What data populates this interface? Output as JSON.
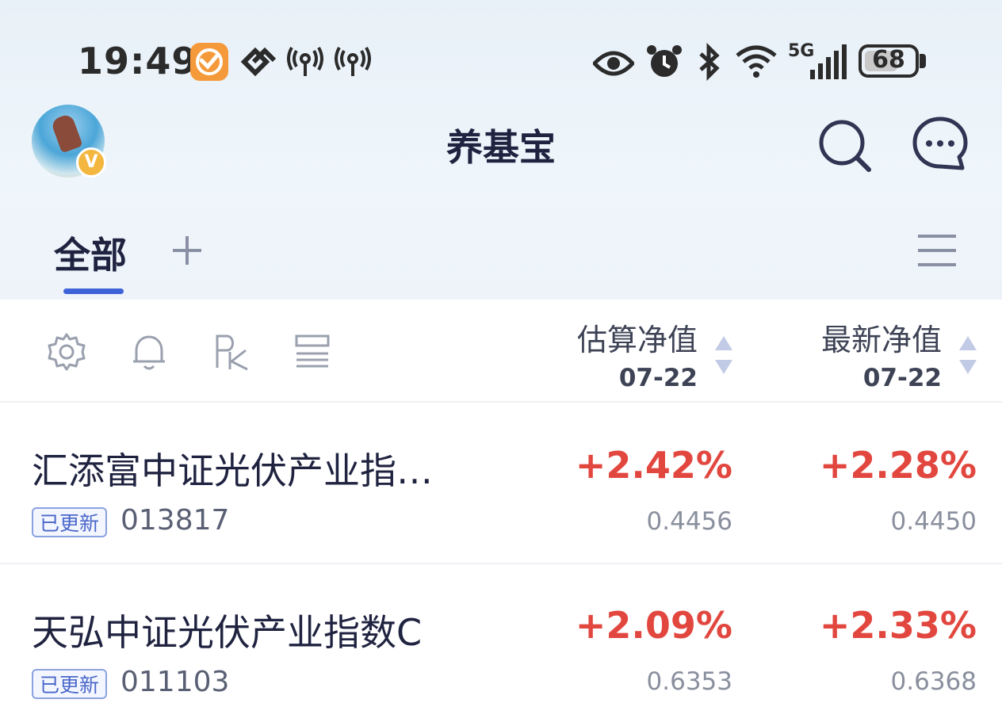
{
  "status_bar": {
    "time": "19:49",
    "network": "5G",
    "battery": "68",
    "icons": [
      "app-badge-icon",
      "link-icon",
      "hotspot-icon",
      "hotspot-icon",
      "eye-icon",
      "alarm-icon",
      "bluetooth-icon",
      "wifi-icon",
      "signal-icon",
      "battery-icon"
    ]
  },
  "header": {
    "title": "养基宝",
    "avatar_badge": "V"
  },
  "tabs": {
    "active": "全部",
    "add_label": "+"
  },
  "columns": {
    "estimate": {
      "label": "估算净值",
      "date": "07-22"
    },
    "latest": {
      "label": "最新净值",
      "date": "07-22"
    }
  },
  "funds": [
    {
      "name": "汇添富中证光伏产业指…",
      "status": "已更新",
      "code": "013817",
      "est_change": "+2.42%",
      "est_nav": "0.4456",
      "latest_change": "+2.28%",
      "latest_nav": "0.4450"
    },
    {
      "name": "天弘中证光伏产业指数C",
      "status": "已更新",
      "code": "011103",
      "est_change": "+2.09%",
      "est_nav": "0.6353",
      "latest_change": "+2.33%",
      "latest_nav": "0.6368"
    }
  ],
  "colors": {
    "up": "#e2473f",
    "accent": "#3e63d8"
  }
}
